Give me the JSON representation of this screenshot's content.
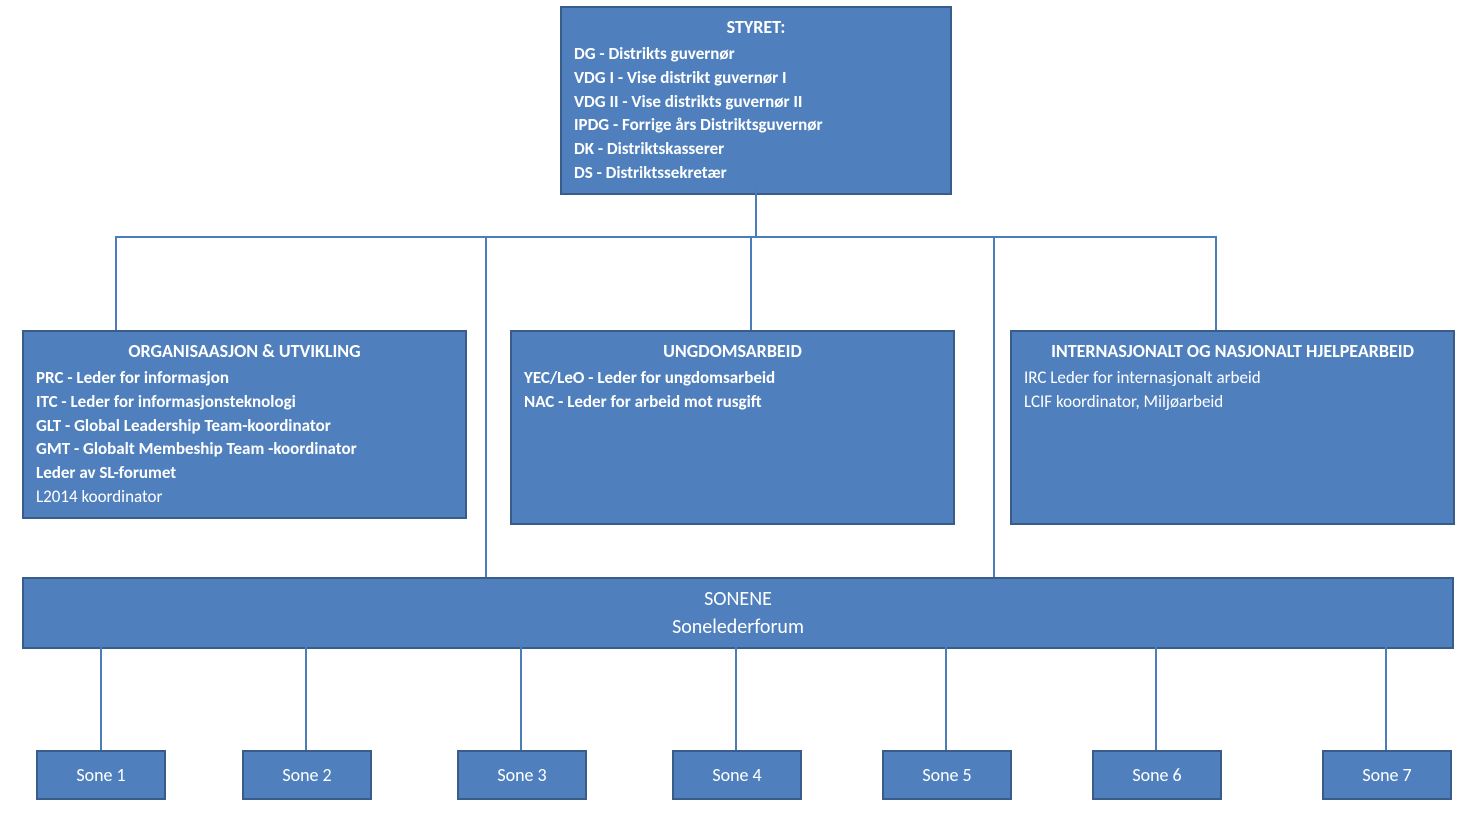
{
  "styret": {
    "title": "STYRET:",
    "lines": [
      "DG - Distrikts guvernør",
      "VDG I - Vise distrikt guvernør I",
      "VDG II - Vise distrikts guvernør II",
      "IPDG - Forrige års Distriktsguvernør",
      "DK - Distriktskasserer",
      "DS - Distriktssekretær"
    ]
  },
  "org": {
    "title": "ORGANISAASJON & UTVIKLING",
    "boldLines": [
      "PRC - Leder for informasjon",
      "ITC - Leder for informasjonsteknologi",
      "GLT - Global Leadership  Team-koordinator",
      "GMT  - Globalt Membeship Team -koordinator",
      "Leder av SL-forumet"
    ],
    "plainLines": [
      "L2014 koordinator"
    ]
  },
  "ungdom": {
    "title": "UNGDOMSARBEID",
    "lines": [
      "YEC/LeO - Leder for ungdomsarbeid",
      "NAC - Leder for arbeid mot rusgift"
    ]
  },
  "inter": {
    "title": "INTERNASJONALT OG NASJONALT HJELPEARBEID",
    "lines": [
      "IRC Leder for internasjonalt arbeid",
      "LCIF koordinator, Miljøarbeid"
    ]
  },
  "sonene": {
    "title": "SONENE",
    "subtitle": "Sonelederforum"
  },
  "soner": [
    "Sone  1",
    "Sone  2",
    "Sone  3",
    "Sone  4",
    "Sone  5",
    "Sone  6",
    "Sone  7"
  ]
}
